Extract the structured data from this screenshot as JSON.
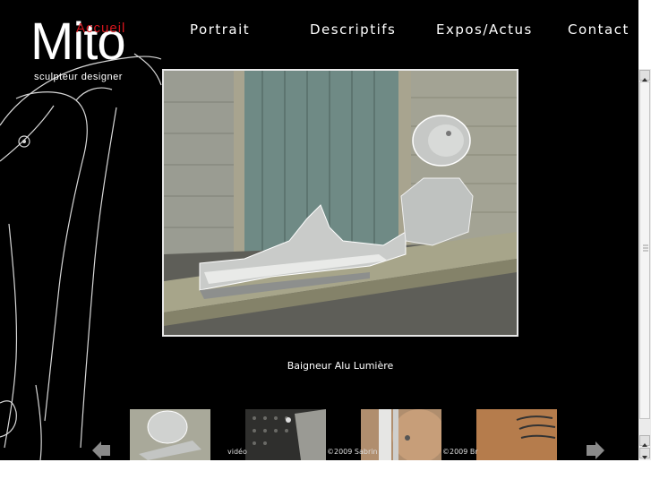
{
  "logo": {
    "name": "Mito",
    "tagline": "sculpteur  designer"
  },
  "nav": {
    "accueil": "Accueil",
    "portrait": "Portrait",
    "descriptifs": "Descriptifs",
    "expos": "Expos/Actus",
    "contact": "Contact"
  },
  "gallery": {
    "caption": "Baigneur Alu Lumière",
    "credits": [
      "vidéo",
      "©2009 Sabrin",
      "©2009 Br"
    ]
  },
  "colors": {
    "background": "#000000",
    "accent": "#d4141c",
    "text": "#ffffff"
  },
  "icons": {
    "prev": "arrow-left-icon",
    "next": "arrow-right-icon"
  }
}
